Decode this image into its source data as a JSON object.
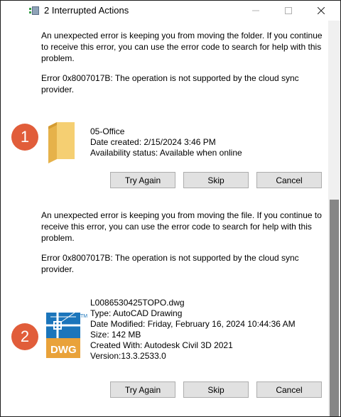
{
  "window": {
    "title": "2 Interrupted Actions",
    "icons": {
      "app": "move-folder-icon",
      "minimize": "minimize-icon",
      "maximize": "maximize-icon",
      "close": "close-icon"
    }
  },
  "items": [
    {
      "badge": "1",
      "message": "An unexpected error is keeping you from moving the folder. If you continue to receive this error, you can use the error code to search for help with this problem.",
      "error": "Error 0x8007017B: The operation is not supported by the cloud sync provider.",
      "icon": "folder-icon",
      "details": [
        "05-Office",
        "Date created: 2/15/2024 3:46 PM",
        "Availability status: Available when online"
      ],
      "buttons": [
        "Try Again",
        "Skip",
        "Cancel"
      ]
    },
    {
      "badge": "2",
      "message": "An unexpected error is keeping you from moving the file. If you continue to receive this error, you can use the error code to search for help with this problem.",
      "error": "Error 0x8007017B: The operation is not supported by the cloud sync provider.",
      "icon": "dwg-file-icon",
      "icon_text": "DWG",
      "icon_tm": "TM",
      "details": [
        "L0086530425TOPO.dwg",
        "Type: AutoCAD Drawing",
        "Date Modified: Friday, February 16, 2024 10:44:36 AM",
        "Size: 142 MB",
        "Created With: Autodesk Civil 3D 2021",
        "Version:13.3.2533.0"
      ],
      "buttons": [
        "Try Again",
        "Skip",
        "Cancel"
      ]
    }
  ],
  "colors": {
    "badge": "#e15d3a",
    "folder": "#f3c865",
    "dwg_blue": "#1b75bb",
    "dwg_orange": "#e9a23a"
  }
}
